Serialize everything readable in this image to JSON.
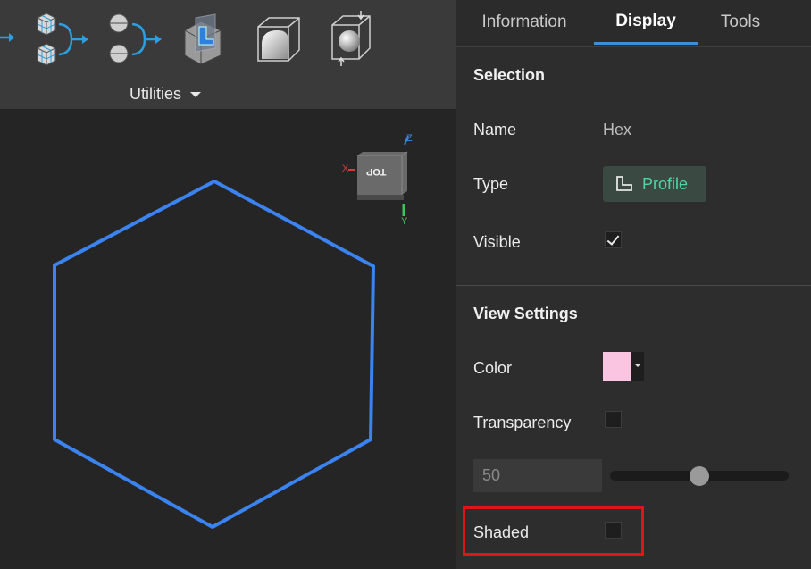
{
  "toolbar": {
    "utilities_label": "Utilities"
  },
  "viewcube": {
    "face_label": "TOP",
    "axis_x": "X",
    "axis_y": "Y",
    "axis_z": "Z"
  },
  "viewport": {
    "profile_color": "#3a83f0"
  },
  "panel": {
    "tabs": [
      {
        "label": "Information",
        "active": false
      },
      {
        "label": "Display",
        "active": true
      },
      {
        "label": "Tools",
        "active": false
      }
    ],
    "selection": {
      "title": "Selection",
      "name_label": "Name",
      "name_value": "Hex",
      "type_label": "Type",
      "type_value": "Profile",
      "type_icon": "profile-icon",
      "visible_label": "Visible",
      "visible_checked": true
    },
    "view_settings": {
      "title": "View Settings",
      "color_label": "Color",
      "color_value": "#f9c5e1",
      "transparency_label": "Transparency",
      "transparency_checked": false,
      "transparency_value": "50",
      "transparency_slider_fraction": 0.5,
      "shaded_label": "Shaded",
      "shaded_checked": false
    }
  }
}
